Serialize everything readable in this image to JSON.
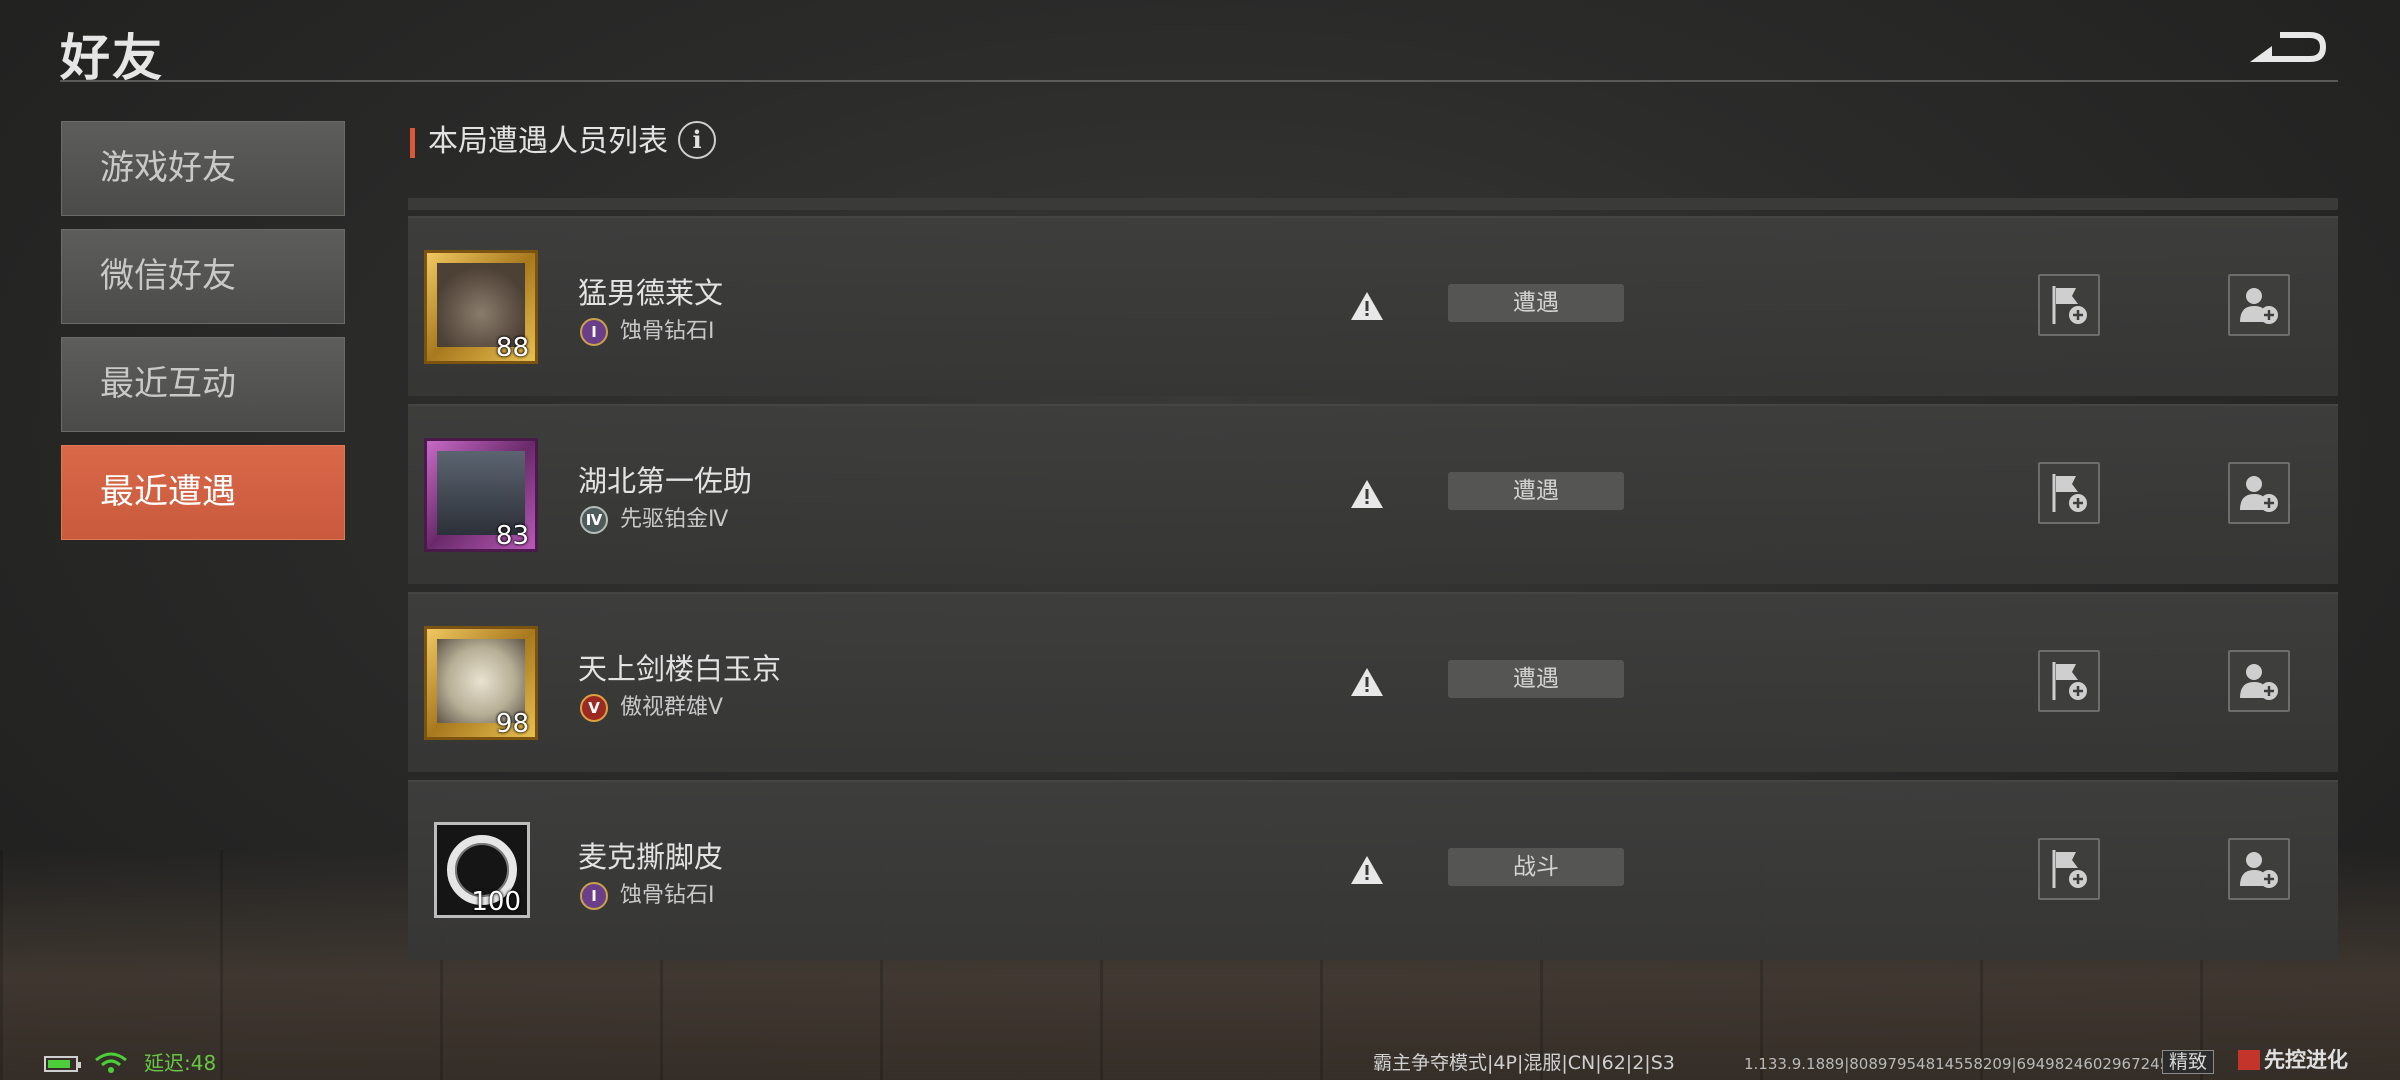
{
  "header": {
    "title": "好友"
  },
  "nav": {
    "tabs": [
      {
        "label": "游戏好友",
        "active": false
      },
      {
        "label": "微信好友",
        "active": false
      },
      {
        "label": "最近互动",
        "active": false
      },
      {
        "label": "最近遭遇",
        "active": true
      }
    ]
  },
  "section": {
    "title": "本局遭遇人员列表",
    "info_icon": "info-icon"
  },
  "players": [
    {
      "name": "猛男德莱文",
      "level": "88",
      "rank": "蚀骨钻石Ⅰ",
      "rank_badge": "Ⅰ",
      "status": "遭遇"
    },
    {
      "name": "湖北第一佐助",
      "level": "83",
      "rank": "先驱铂金Ⅳ",
      "rank_badge": "Ⅳ",
      "status": "遭遇"
    },
    {
      "name": "天上剑楼白玉京",
      "level": "98",
      "rank": "傲视群雄Ⅴ",
      "rank_badge": "Ⅴ",
      "status": "遭遇"
    },
    {
      "name": "麦克撕脚皮",
      "level": "100",
      "rank": "蚀骨钻石Ⅰ",
      "rank_badge": "Ⅰ",
      "status": "战斗"
    }
  ],
  "statusbar": {
    "latency": "延迟:48",
    "mode": "霸主争夺模式|4P|混服|CN|62|2|S3",
    "version": "1.133.9.1889|8089795481455820​9|69498246029672450",
    "quality": "精致",
    "brand": "先控进化"
  },
  "colors": {
    "accent": "#d9593a",
    "active_tab": "#c95a3c",
    "latency_green": "#67c745"
  }
}
